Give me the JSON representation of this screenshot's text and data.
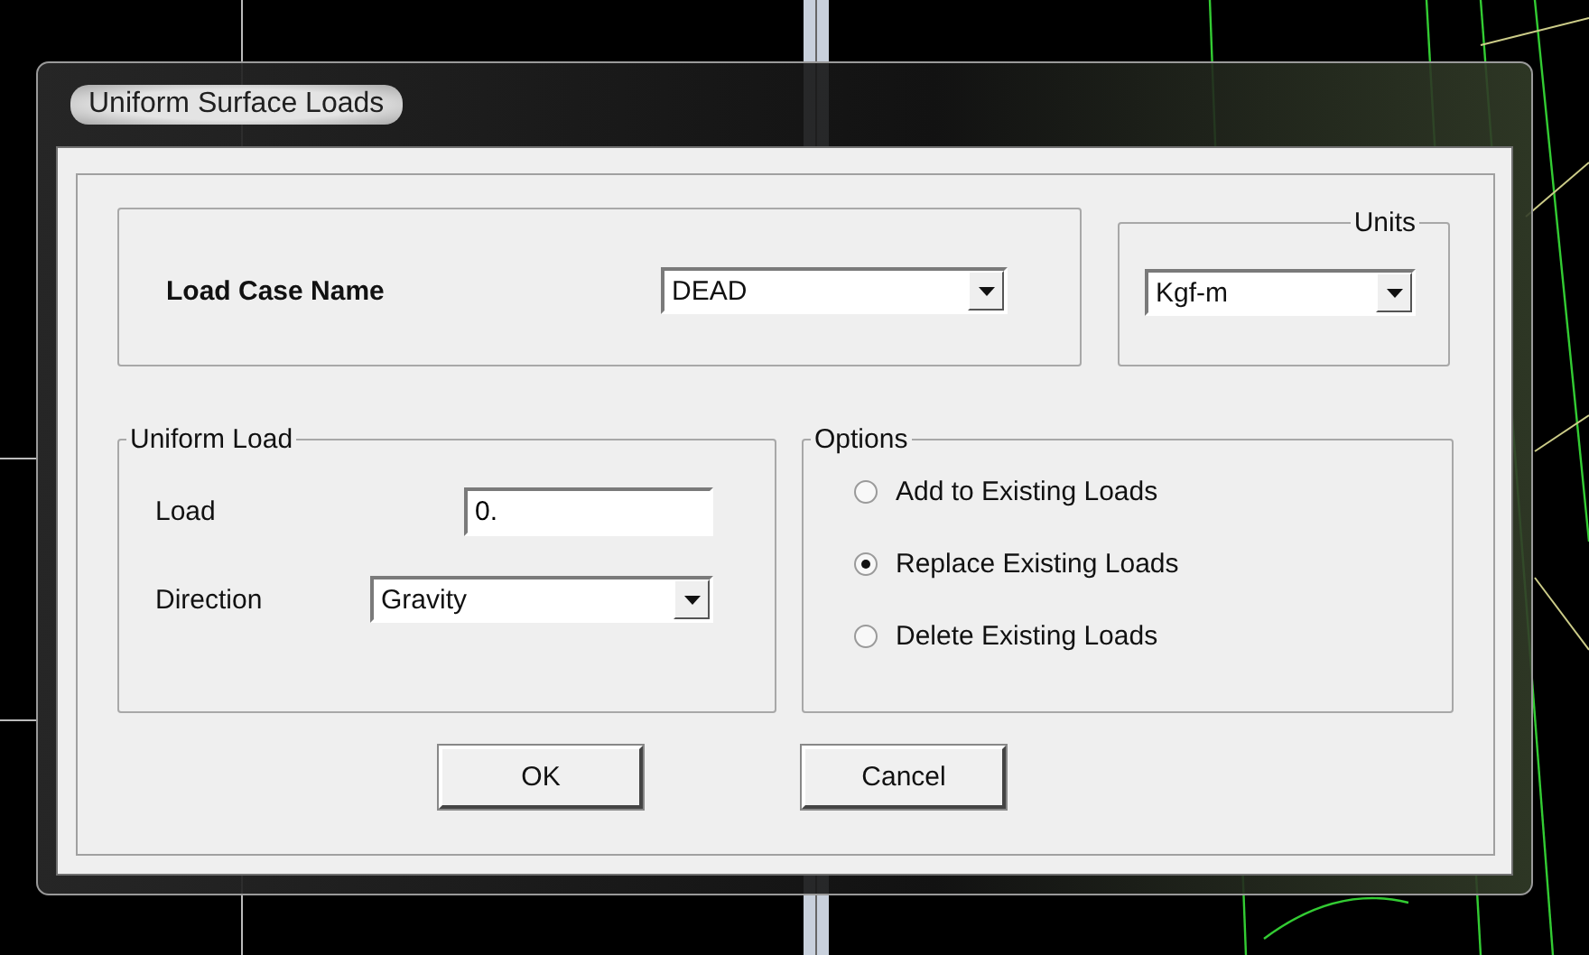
{
  "window": {
    "title": "Uniform Surface Loads"
  },
  "load_case": {
    "label": "Load Case Name",
    "value": "DEAD"
  },
  "units": {
    "legend": "Units",
    "value": "Kgf-m"
  },
  "uniform_load": {
    "legend": "Uniform Load",
    "load": {
      "label": "Load",
      "value": "0."
    },
    "direction": {
      "label": "Direction",
      "value": "Gravity"
    }
  },
  "options": {
    "legend": "Options",
    "items": [
      {
        "label": "Add to Existing Loads",
        "selected": false
      },
      {
        "label": "Replace Existing Loads",
        "selected": true
      },
      {
        "label": "Delete Existing Loads",
        "selected": false
      }
    ]
  },
  "buttons": [
    "OK",
    "Cancel"
  ]
}
